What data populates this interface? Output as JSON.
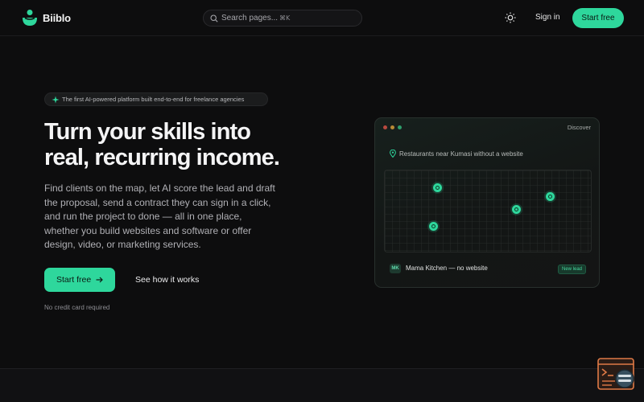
{
  "header": {
    "brand": "Biiblo",
    "search_placeholder": "Search pages...",
    "search_shortcut": "⌘K",
    "signin_label": "Sign in",
    "start_label": "Start free",
    "icons": [
      "logo",
      "search-icon",
      "sun-icon"
    ]
  },
  "hero": {
    "badge_text": "The first AI-powered platform built end-to-end for freelance agencies",
    "headline_line1": "Turn your skills into",
    "headline_line2": "real, recurring income.",
    "paragraph": "Find clients on the map, let AI score the lead and draft the proposal, send a contract they can sign in a click, and run the project to done — all in one place, whether you build websites and software or offer design, video, or marketing services.",
    "cta_label": "Start free",
    "secondary_label": "See how it works",
    "note": "No credit card required"
  },
  "preview": {
    "tab_label": "Discover",
    "query": "Restaurants near Kumasi without a website",
    "lead_initials": "MK",
    "lead_name": "Mama Kitchen — no website",
    "lead_tag": "New lead"
  },
  "colors": {
    "accent": "#2ed79c",
    "background": "#0d0d0e",
    "dot_red": "#b8493f",
    "dot_amber": "#b88a35",
    "dot_green": "#2e9e6c"
  }
}
